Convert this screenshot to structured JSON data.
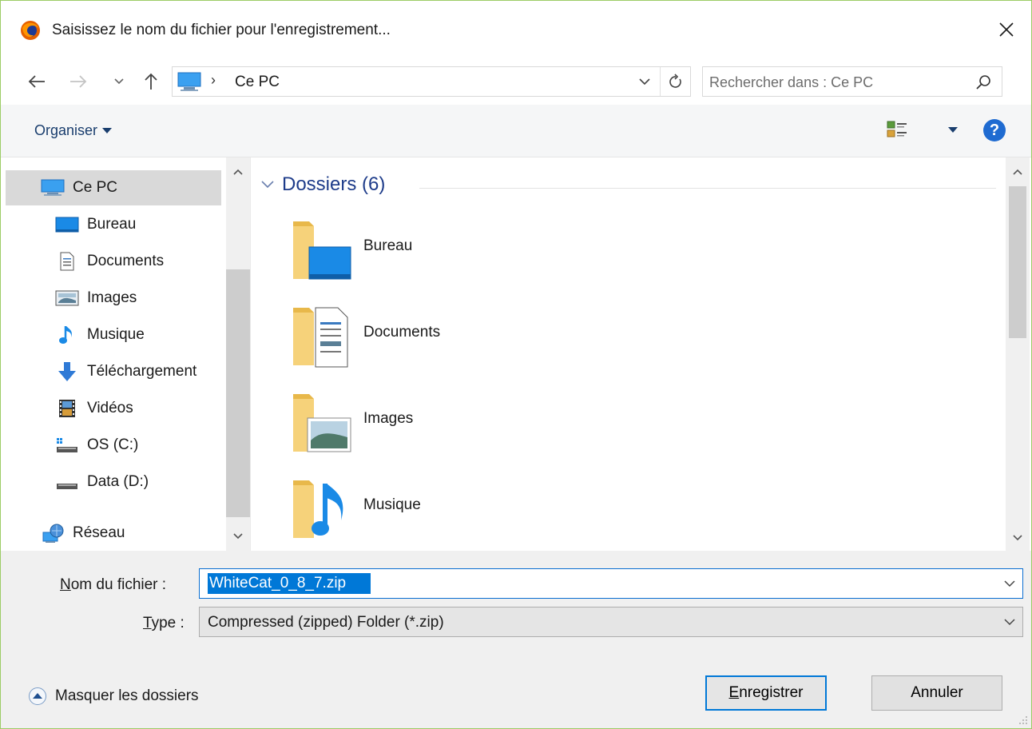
{
  "window": {
    "title": "Saisissez le nom du fichier pour l'enregistrement..."
  },
  "nav": {
    "address": "Ce PC",
    "address_separator": "›",
    "search_placeholder": "Rechercher dans : Ce PC"
  },
  "toolbar": {
    "organise_label": "Organiser",
    "help_label": "?"
  },
  "sidebar": {
    "items": [
      {
        "label": "Ce PC",
        "icon": "computer-icon",
        "selected": true
      },
      {
        "label": "Bureau",
        "icon": "desktop-icon"
      },
      {
        "label": "Documents",
        "icon": "documents-icon"
      },
      {
        "label": "Images",
        "icon": "images-icon"
      },
      {
        "label": "Musique",
        "icon": "music-icon"
      },
      {
        "label": "Téléchargement",
        "icon": "downloads-icon"
      },
      {
        "label": "Vidéos",
        "icon": "videos-icon"
      },
      {
        "label": "OS (C:)",
        "icon": "os-drive-icon"
      },
      {
        "label": "Data (D:)",
        "icon": "drive-icon"
      },
      {
        "label": "Réseau",
        "icon": "network-icon"
      }
    ]
  },
  "main": {
    "group_title": "Dossiers (6)",
    "folders": [
      {
        "label": "Bureau",
        "icon": "desktop-folder-icon"
      },
      {
        "label": "Documents",
        "icon": "documents-folder-icon"
      },
      {
        "label": "Images",
        "icon": "images-folder-icon"
      },
      {
        "label": "Musique",
        "icon": "music-folder-icon"
      }
    ]
  },
  "form": {
    "filename_label_accel": "N",
    "filename_label_rest": "om du fichier :",
    "filename_value": "WhiteCat_0_8_7.zip",
    "type_label_accel": "T",
    "type_label_rest": "ype :",
    "type_value": "Compressed (zipped) Folder (*.zip)"
  },
  "footer": {
    "hide_folders_label": "Masquer les dossiers",
    "save_label_accel": "E",
    "save_label_rest": "nregistrer",
    "cancel_label": "Annuler"
  },
  "colors": {
    "accent": "#0078d7",
    "group_header": "#1e3c8a",
    "window_border": "#9ccc65"
  }
}
